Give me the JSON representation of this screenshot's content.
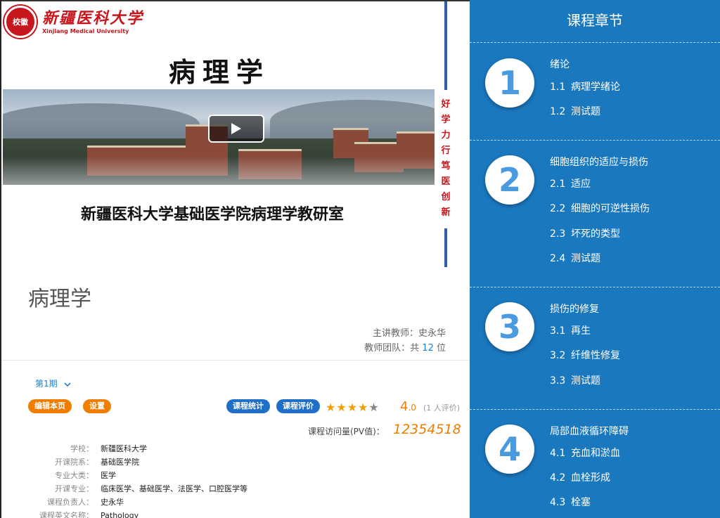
{
  "school": {
    "seal_text": "校徽",
    "name_cn": "新疆医科大学",
    "name_en": "Xinjiang Medical University",
    "motto": [
      "好",
      "学",
      "力",
      "行",
      "笃",
      "医",
      "创",
      "新"
    ]
  },
  "banner": {
    "title": "病理学",
    "department": "新疆医科大学基础医学院病理学教研室"
  },
  "course": {
    "name": "病理学",
    "teacher_label": "主讲教师：",
    "teacher": "史永华",
    "team_prefix": "教师团队：共",
    "team_count": "12",
    "team_suffix": "位"
  },
  "term": {
    "label": "第1期",
    "icon": "chevron-down-icon"
  },
  "actions": {
    "edit": "编辑本页",
    "settings": "设置",
    "stats": "课程统计",
    "review": "课程评价"
  },
  "rating": {
    "stars_filled": 4,
    "stars_total": 5,
    "score": "4",
    "score_decimal": ".0",
    "count_text": "(1 人评价)"
  },
  "pv": {
    "label": "课程访问量(PV值)：",
    "value": "12354518"
  },
  "info": [
    {
      "k": "学校：",
      "v": "新疆医科大学"
    },
    {
      "k": "开课院系：",
      "v": "基础医学院"
    },
    {
      "k": "专业大类：",
      "v": "医学"
    },
    {
      "k": "开课专业：",
      "v": "临床医学、基础医学、法医学、口腔医学等"
    },
    {
      "k": "课程负责人：",
      "v": "史永华"
    },
    {
      "k": "课程英文名称：",
      "v": "Pathology"
    }
  ],
  "chapters_panel": {
    "title": "课程章节",
    "chapters": [
      {
        "num": "1",
        "title": "绪论",
        "items": [
          {
            "n": "1.1",
            "t": "病理学绪论"
          },
          {
            "n": "1.2",
            "t": "测试题"
          }
        ]
      },
      {
        "num": "2",
        "title": "细胞组织的适应与损伤",
        "items": [
          {
            "n": "2.1",
            "t": "适应"
          },
          {
            "n": "2.2",
            "t": "细胞的可逆性损伤"
          },
          {
            "n": "2.3",
            "t": "坏死的类型"
          },
          {
            "n": "2.4",
            "t": "测试题"
          }
        ]
      },
      {
        "num": "3",
        "title": "损伤的修复",
        "items": [
          {
            "n": "3.1",
            "t": "再生"
          },
          {
            "n": "3.2",
            "t": "纤维性修复"
          },
          {
            "n": "3.3",
            "t": "测试题"
          }
        ]
      },
      {
        "num": "4",
        "title": "局部血液循环障碍",
        "items": [
          {
            "n": "4.1",
            "t": "充血和淤血"
          },
          {
            "n": "4.2",
            "t": "血栓形成"
          },
          {
            "n": "4.3",
            "t": "栓塞"
          }
        ]
      }
    ]
  },
  "colors": {
    "panel_blue": "#1a78bf",
    "accent_orange": "#f07d00",
    "brand_red": "#c8161d",
    "link_blue": "#1f7fd0"
  }
}
